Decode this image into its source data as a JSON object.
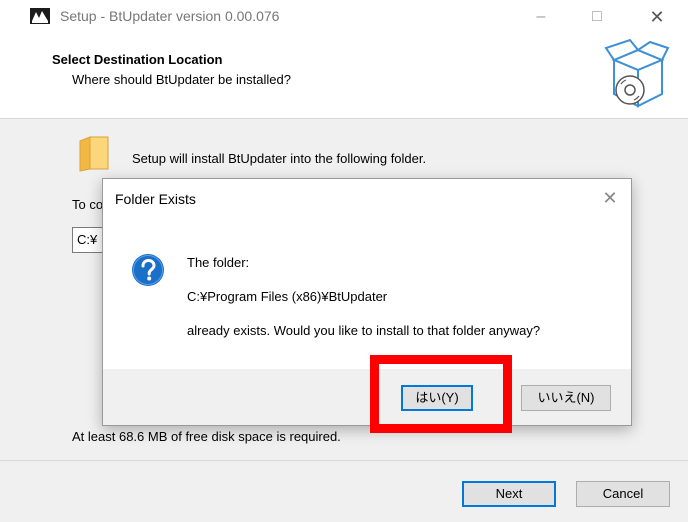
{
  "window": {
    "title": "Setup - BtUpdater version 0.00.076",
    "app_icon": "installer-app-icon",
    "minimize_glyph": "–",
    "maximize_glyph": "□",
    "close_glyph": "✕"
  },
  "header": {
    "title": "Select Destination Location",
    "subtitle": "Where should BtUpdater be installed?",
    "graphic_icon": "setup-box-cd-icon"
  },
  "content": {
    "folder_icon": "folder-icon",
    "install_text": "Setup will install BtUpdater into the following folder.",
    "continue_text_visible": "To co",
    "path_value_visible": "C:¥",
    "disk_space_text": "At least 68.6 MB of free disk space is required."
  },
  "footer": {
    "next_label": "Next",
    "cancel_label": "Cancel"
  },
  "dialog": {
    "title": "Folder Exists",
    "close_glyph": "✕",
    "icon": "question-icon",
    "line1": "The folder:",
    "line2": "C:¥Program Files (x86)¥BtUpdater",
    "line3": "already exists. Would you like to install to that folder anyway?",
    "yes_label": "はい(Y)",
    "no_label": "いいえ(N)"
  },
  "colors": {
    "highlight": "#ff0000",
    "focus_border": "#0078d7",
    "panel_bg": "#f0f0f0",
    "question_icon": "#1a6fc9"
  }
}
